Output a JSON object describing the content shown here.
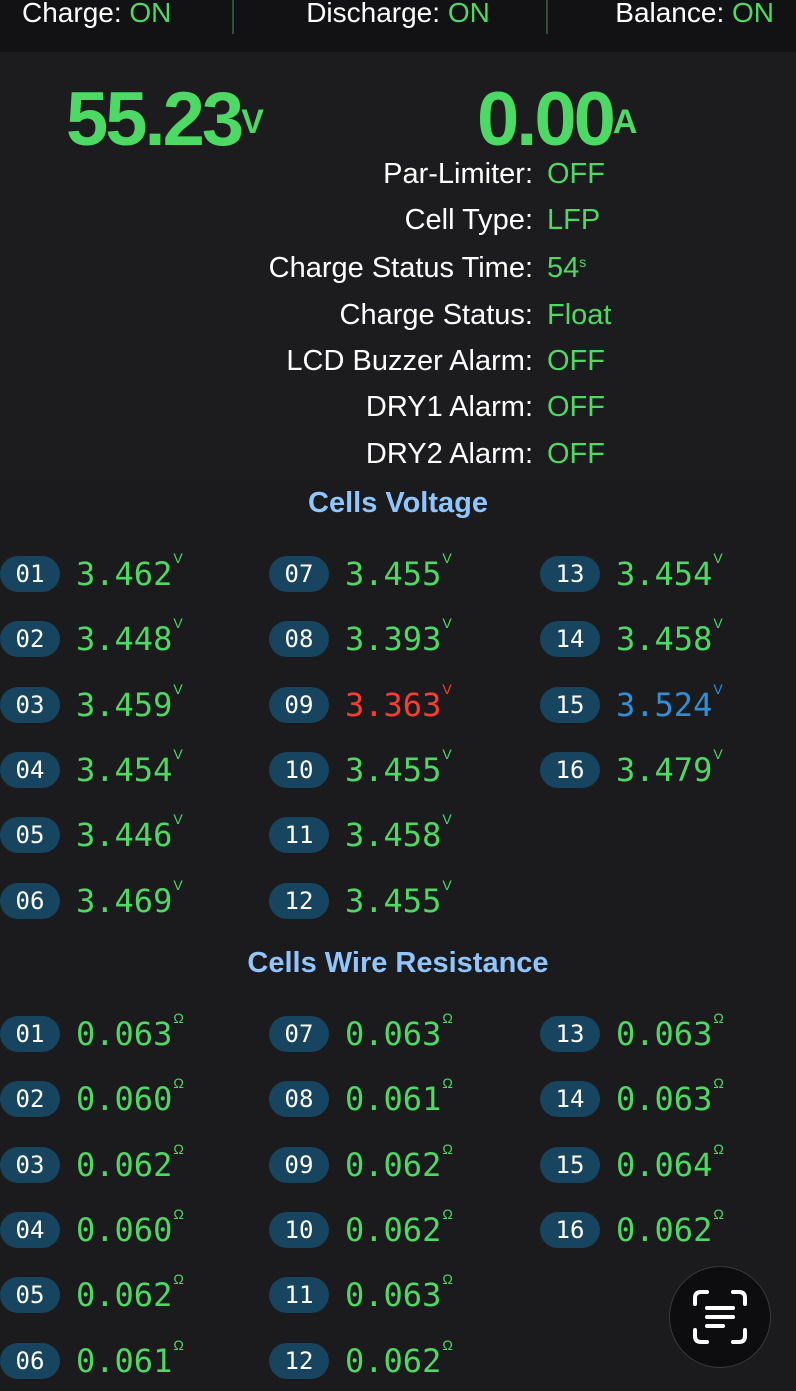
{
  "header": {
    "charge_label": "Charge: ",
    "charge_value": "ON",
    "discharge_label": "Discharge: ",
    "discharge_value": "ON",
    "balance_label": "Balance: ",
    "balance_value": "ON"
  },
  "summary": {
    "voltage": "55.23",
    "voltage_unit": "V",
    "current": "0.00",
    "current_unit": "A"
  },
  "status": [
    {
      "label": "Par-Limiter:",
      "value": "OFF"
    },
    {
      "label": "Cell Type:",
      "value": "LFP"
    },
    {
      "label": "Charge Status Time:",
      "value": "54",
      "unit": "s"
    },
    {
      "label": "Charge Status:",
      "value": "Float"
    },
    {
      "label": "LCD Buzzer Alarm:",
      "value": "OFF"
    },
    {
      "label": "DRY1 Alarm:",
      "value": "OFF"
    },
    {
      "label": "DRY2 Alarm:",
      "value": "OFF"
    }
  ],
  "colors": {
    "ok": "#4cd964",
    "low": "#ff3b30",
    "high": "#2f8fd8",
    "title": "#8fc6ff",
    "badge": "#17445e"
  },
  "voltage_section": {
    "title": "Cells Voltage",
    "unit": "V",
    "cells": [
      {
        "id": "01",
        "value": "3.462",
        "state": "normal"
      },
      {
        "id": "02",
        "value": "3.448",
        "state": "normal"
      },
      {
        "id": "03",
        "value": "3.459",
        "state": "normal"
      },
      {
        "id": "04",
        "value": "3.454",
        "state": "normal"
      },
      {
        "id": "05",
        "value": "3.446",
        "state": "normal"
      },
      {
        "id": "06",
        "value": "3.469",
        "state": "normal"
      },
      {
        "id": "07",
        "value": "3.455",
        "state": "normal"
      },
      {
        "id": "08",
        "value": "3.393",
        "state": "normal"
      },
      {
        "id": "09",
        "value": "3.363",
        "state": "min"
      },
      {
        "id": "10",
        "value": "3.455",
        "state": "normal"
      },
      {
        "id": "11",
        "value": "3.458",
        "state": "normal"
      },
      {
        "id": "12",
        "value": "3.455",
        "state": "normal"
      },
      {
        "id": "13",
        "value": "3.454",
        "state": "normal"
      },
      {
        "id": "14",
        "value": "3.458",
        "state": "normal"
      },
      {
        "id": "15",
        "value": "3.524",
        "state": "max"
      },
      {
        "id": "16",
        "value": "3.479",
        "state": "normal"
      }
    ]
  },
  "resistance_section": {
    "title": "Cells Wire Resistance",
    "unit": "Ω",
    "cells": [
      {
        "id": "01",
        "value": "0.063"
      },
      {
        "id": "02",
        "value": "0.060"
      },
      {
        "id": "03",
        "value": "0.062"
      },
      {
        "id": "04",
        "value": "0.060"
      },
      {
        "id": "05",
        "value": "0.062"
      },
      {
        "id": "06",
        "value": "0.061"
      },
      {
        "id": "07",
        "value": "0.063"
      },
      {
        "id": "08",
        "value": "0.061"
      },
      {
        "id": "09",
        "value": "0.062"
      },
      {
        "id": "10",
        "value": "0.062"
      },
      {
        "id": "11",
        "value": "0.063"
      },
      {
        "id": "12",
        "value": "0.062"
      },
      {
        "id": "13",
        "value": "0.063"
      },
      {
        "id": "14",
        "value": "0.063"
      },
      {
        "id": "15",
        "value": "0.064"
      },
      {
        "id": "16",
        "value": "0.062"
      }
    ]
  },
  "fab": {
    "icon": "live-text-scan-icon"
  }
}
